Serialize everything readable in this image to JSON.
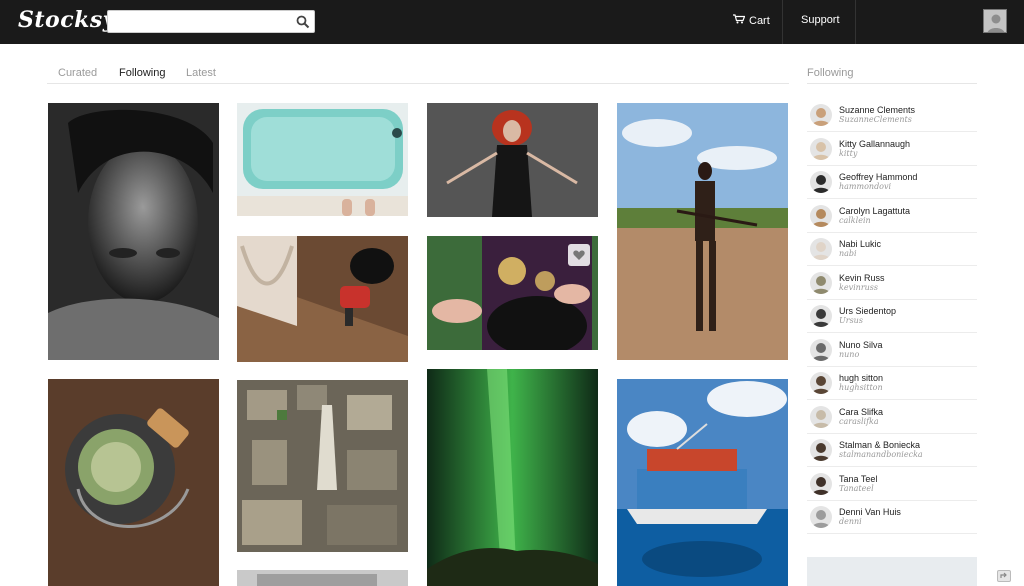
{
  "header": {
    "logo": "Stocksy",
    "search": {
      "placeholder": "",
      "value": ""
    },
    "cart_label": "Cart",
    "support_label": "Support"
  },
  "tabs": [
    {
      "label": "Curated",
      "active": false
    },
    {
      "label": "Following",
      "active": true
    },
    {
      "label": "Latest",
      "active": false
    }
  ],
  "sidebar": {
    "title": "Following",
    "users": [
      {
        "name": "Suzanne Clements",
        "handle": "SuzanneClements"
      },
      {
        "name": "Kitty Gallannaugh",
        "handle": "kitty"
      },
      {
        "name": "Geoffrey Hammond",
        "handle": "hammondovi"
      },
      {
        "name": "Carolyn Lagattuta",
        "handle": "calklein"
      },
      {
        "name": "Nabi Lukic",
        "handle": "nabi"
      },
      {
        "name": "Kevin Russ",
        "handle": "kevinruss"
      },
      {
        "name": "Urs Siedentop",
        "handle": "Ursus"
      },
      {
        "name": "Nuno Silva",
        "handle": "nuno"
      },
      {
        "name": "hugh sitton",
        "handle": "hughsitton"
      },
      {
        "name": "Cara Slifka",
        "handle": "caraslifka"
      },
      {
        "name": "Stalman & Boniecka",
        "handle": "stalmanandboniecka"
      },
      {
        "name": "Tana Teel",
        "handle": "Tanateel"
      },
      {
        "name": "Denni Van Huis",
        "handle": "denni"
      }
    ]
  },
  "colors": {
    "topbar": "#1a1a1a",
    "tab_active": "#222222",
    "tab_inactive": "#9a9a9a"
  },
  "icons": {
    "search": "search-icon",
    "cart": "cart-icon",
    "heart": "heart-icon",
    "share": "share-icon"
  }
}
